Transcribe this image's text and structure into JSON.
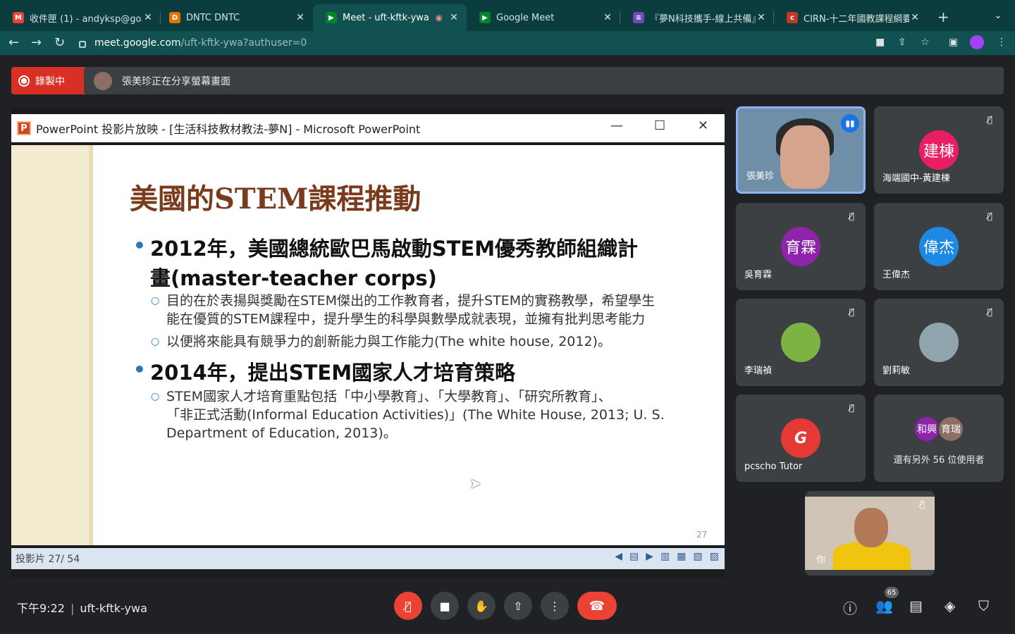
{
  "browser": {
    "tabs": [
      {
        "title": "收件匣 (1) - andyksp@go.e",
        "icon": "gmail-icon",
        "color": "#ea4335",
        "glyph": "M"
      },
      {
        "title": "DNTC DNTC",
        "icon": "dntc-icon",
        "color": "#e37400",
        "glyph": "D"
      },
      {
        "title": "Meet - uft-kftk-ywa",
        "icon": "meet-icon",
        "color": "#00832d",
        "glyph": "▶",
        "active": true
      },
      {
        "title": "Google Meet",
        "icon": "meet-icon",
        "color": "#00832d",
        "glyph": "▶"
      },
      {
        "title": "『夢N科技攜手-線上共備』",
        "icon": "forms-icon",
        "color": "#7248b9",
        "glyph": "≡"
      },
      {
        "title": "CIRN-十二年國教課程綱要",
        "icon": "cirn-icon",
        "color": "#c0392b",
        "glyph": "c"
      }
    ],
    "url_host": "meet.google.com",
    "url_path": "/uft-kftk-ywa?authuser=0"
  },
  "meet": {
    "recording_label": "錄製中",
    "share_banner": "張美珍正在分享螢幕畫面",
    "meeting_code": "uft-kftk-ywa",
    "time": "下午9:22",
    "participant_count": "65"
  },
  "ppt": {
    "window_title": "PowerPoint 投影片放映 - [生活科技教材教法-夢N] - Microsoft PowerPoint",
    "slide_title": "美國的STEM課程推動",
    "bullet1_line1": "2012年，美國總統歐巴馬啟動STEM優秀教師組織計",
    "bullet1_line2": "畫(master-teacher corps)",
    "sub1_line1": "目的在於表揚與獎勵在STEM傑出的工作教育者，提升STEM的實務教學，希望學生",
    "sub1_line2": "能在優質的STEM課程中，提升學生的科學與數學成就表現，並擁有批判思考能力",
    "sub2": "以便將來能具有競爭力的創新能力與工作能力(The white house, 2012)。",
    "bullet2": "2014年，提出STEM國家人才培育策略",
    "sub3_line1": "STEM國家人才培育重點包括「中小學教育」、「大學教育」、「研究所教育」、",
    "sub3_line2": "「非正式活動(Informal Education Activities)」(The White House, 2013; U. S.",
    "sub3_line3": "Department of Education, 2013)。",
    "page_number": "27",
    "status": "投影片 27/ 54"
  },
  "participants": [
    {
      "name": "張美珍",
      "type": "video",
      "speaking": true
    },
    {
      "name": "海端國中-黃建棟",
      "initials": "建棟",
      "color": "#e91e63",
      "muted": true
    },
    {
      "name": "吳育霖",
      "initials": "育霖",
      "color": "#8e24aa",
      "muted": true
    },
    {
      "name": "王偉杰",
      "initials": "偉杰",
      "color": "#1e88e5",
      "muted": true
    },
    {
      "name": "李瑞禎",
      "initials": "",
      "color": "#7cb342",
      "muted": true
    },
    {
      "name": "劉莉敏",
      "initials": "",
      "color": "#90a4ae",
      "muted": true
    },
    {
      "name": "pcscho Tutor",
      "initials": "G",
      "color": "#e53935",
      "muted": true
    }
  ],
  "others": {
    "avatars": [
      {
        "text": "和興",
        "color": "#8e24aa"
      },
      {
        "text": "育瑞",
        "color": "#8d6e63"
      }
    ],
    "label": "還有另外 56 位使用者"
  },
  "self_view": {
    "label": "你"
  }
}
